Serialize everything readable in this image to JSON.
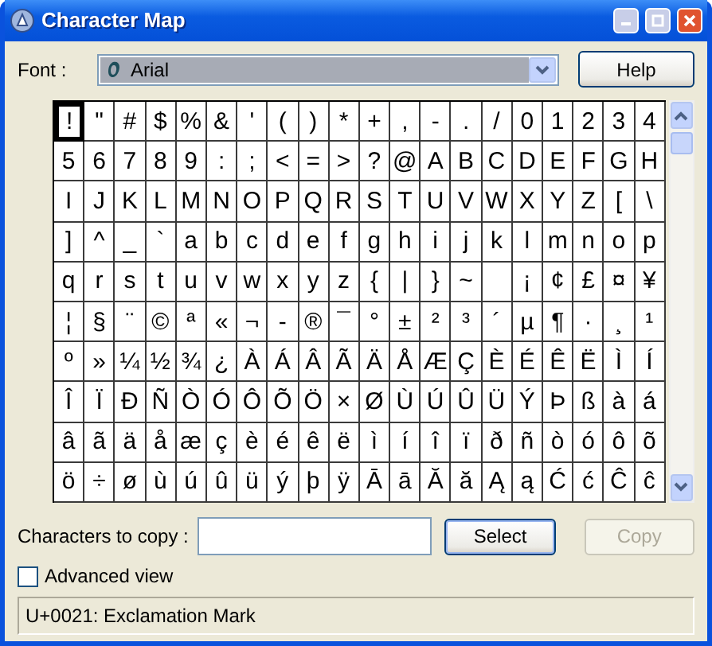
{
  "window": {
    "title": "Character Map"
  },
  "font": {
    "label": "Font :",
    "value": "Arial"
  },
  "help_button": "Help",
  "grid": {
    "rows": [
      {
        "cells": [
          {
            "c": "!",
            "selected": true
          },
          {
            "c": "\"",
            "selected": false
          },
          {
            "c": "#",
            "selected": false
          },
          {
            "c": "$",
            "selected": false
          },
          {
            "c": "%",
            "selected": false
          },
          {
            "c": "&",
            "selected": false
          },
          {
            "c": "'",
            "selected": false
          },
          {
            "c": "(",
            "selected": false
          },
          {
            "c": ")",
            "selected": false
          },
          {
            "c": "*",
            "selected": false
          },
          {
            "c": "+",
            "selected": false
          },
          {
            "c": ",",
            "selected": false
          },
          {
            "c": "-",
            "selected": false
          },
          {
            "c": ".",
            "selected": false
          },
          {
            "c": "/",
            "selected": false
          },
          {
            "c": "0",
            "selected": false
          },
          {
            "c": "1",
            "selected": false
          },
          {
            "c": "2",
            "selected": false
          },
          {
            "c": "3",
            "selected": false
          },
          {
            "c": "4",
            "selected": false
          }
        ]
      },
      {
        "cells": [
          {
            "c": "5",
            "selected": false
          },
          {
            "c": "6",
            "selected": false
          },
          {
            "c": "7",
            "selected": false
          },
          {
            "c": "8",
            "selected": false
          },
          {
            "c": "9",
            "selected": false
          },
          {
            "c": ":",
            "selected": false
          },
          {
            "c": ";",
            "selected": false
          },
          {
            "c": "<",
            "selected": false
          },
          {
            "c": "=",
            "selected": false
          },
          {
            "c": ">",
            "selected": false
          },
          {
            "c": "?",
            "selected": false
          },
          {
            "c": "@",
            "selected": false
          },
          {
            "c": "A",
            "selected": false
          },
          {
            "c": "B",
            "selected": false
          },
          {
            "c": "C",
            "selected": false
          },
          {
            "c": "D",
            "selected": false
          },
          {
            "c": "E",
            "selected": false
          },
          {
            "c": "F",
            "selected": false
          },
          {
            "c": "G",
            "selected": false
          },
          {
            "c": "H",
            "selected": false
          }
        ]
      },
      {
        "cells": [
          {
            "c": "I",
            "selected": false
          },
          {
            "c": "J",
            "selected": false
          },
          {
            "c": "K",
            "selected": false
          },
          {
            "c": "L",
            "selected": false
          },
          {
            "c": "M",
            "selected": false
          },
          {
            "c": "N",
            "selected": false
          },
          {
            "c": "O",
            "selected": false
          },
          {
            "c": "P",
            "selected": false
          },
          {
            "c": "Q",
            "selected": false
          },
          {
            "c": "R",
            "selected": false
          },
          {
            "c": "S",
            "selected": false
          },
          {
            "c": "T",
            "selected": false
          },
          {
            "c": "U",
            "selected": false
          },
          {
            "c": "V",
            "selected": false
          },
          {
            "c": "W",
            "selected": false
          },
          {
            "c": "X",
            "selected": false
          },
          {
            "c": "Y",
            "selected": false
          },
          {
            "c": "Z",
            "selected": false
          },
          {
            "c": "[",
            "selected": false
          },
          {
            "c": "\\",
            "selected": false
          }
        ]
      },
      {
        "cells": [
          {
            "c": "]",
            "selected": false
          },
          {
            "c": "^",
            "selected": false
          },
          {
            "c": "_",
            "selected": false
          },
          {
            "c": "`",
            "selected": false
          },
          {
            "c": "a",
            "selected": false
          },
          {
            "c": "b",
            "selected": false
          },
          {
            "c": "c",
            "selected": false
          },
          {
            "c": "d",
            "selected": false
          },
          {
            "c": "e",
            "selected": false
          },
          {
            "c": "f",
            "selected": false
          },
          {
            "c": "g",
            "selected": false
          },
          {
            "c": "h",
            "selected": false
          },
          {
            "c": "i",
            "selected": false
          },
          {
            "c": "j",
            "selected": false
          },
          {
            "c": "k",
            "selected": false
          },
          {
            "c": "l",
            "selected": false
          },
          {
            "c": "m",
            "selected": false
          },
          {
            "c": "n",
            "selected": false
          },
          {
            "c": "o",
            "selected": false
          },
          {
            "c": "p",
            "selected": false
          }
        ]
      },
      {
        "cells": [
          {
            "c": "q",
            "selected": false
          },
          {
            "c": "r",
            "selected": false
          },
          {
            "c": "s",
            "selected": false
          },
          {
            "c": "t",
            "selected": false
          },
          {
            "c": "u",
            "selected": false
          },
          {
            "c": "v",
            "selected": false
          },
          {
            "c": "w",
            "selected": false
          },
          {
            "c": "x",
            "selected": false
          },
          {
            "c": "y",
            "selected": false
          },
          {
            "c": "z",
            "selected": false
          },
          {
            "c": "{",
            "selected": false
          },
          {
            "c": "|",
            "selected": false
          },
          {
            "c": "}",
            "selected": false
          },
          {
            "c": "~",
            "selected": false
          },
          {
            "selected": false
          },
          {
            "c": "¡",
            "selected": false
          },
          {
            "c": "¢",
            "selected": false
          },
          {
            "c": "£",
            "selected": false
          },
          {
            "c": "¤",
            "selected": false
          },
          {
            "c": "¥",
            "selected": false
          }
        ]
      },
      {
        "cells": [
          {
            "c": "¦",
            "selected": false
          },
          {
            "c": "§",
            "selected": false
          },
          {
            "c": "¨",
            "selected": false
          },
          {
            "c": "©",
            "selected": false
          },
          {
            "c": "ª",
            "selected": false
          },
          {
            "c": "«",
            "selected": false
          },
          {
            "c": "¬",
            "selected": false
          },
          {
            "c": "-",
            "selected": false
          },
          {
            "c": "®",
            "selected": false
          },
          {
            "c": "¯",
            "selected": false
          },
          {
            "c": "°",
            "selected": false
          },
          {
            "c": "±",
            "selected": false
          },
          {
            "c": "²",
            "selected": false
          },
          {
            "c": "³",
            "selected": false
          },
          {
            "c": "´",
            "selected": false
          },
          {
            "c": "µ",
            "selected": false
          },
          {
            "c": "¶",
            "selected": false
          },
          {
            "c": "·",
            "selected": false
          },
          {
            "c": "¸",
            "selected": false
          },
          {
            "c": "¹",
            "selected": false
          }
        ]
      },
      {
        "cells": [
          {
            "c": "º",
            "selected": false
          },
          {
            "c": "»",
            "selected": false
          },
          {
            "c": "¼",
            "selected": false
          },
          {
            "c": "½",
            "selected": false
          },
          {
            "c": "¾",
            "selected": false
          },
          {
            "c": "¿",
            "selected": false
          },
          {
            "c": "À",
            "selected": false
          },
          {
            "c": "Á",
            "selected": false
          },
          {
            "c": "Â",
            "selected": false
          },
          {
            "c": "Ã",
            "selected": false
          },
          {
            "c": "Ä",
            "selected": false
          },
          {
            "c": "Å",
            "selected": false
          },
          {
            "c": "Æ",
            "selected": false
          },
          {
            "c": "Ç",
            "selected": false
          },
          {
            "c": "È",
            "selected": false
          },
          {
            "c": "É",
            "selected": false
          },
          {
            "c": "Ê",
            "selected": false
          },
          {
            "c": "Ë",
            "selected": false
          },
          {
            "c": "Ì",
            "selected": false
          },
          {
            "c": "Í",
            "selected": false
          }
        ]
      },
      {
        "cells": [
          {
            "c": "Î",
            "selected": false
          },
          {
            "c": "Ï",
            "selected": false
          },
          {
            "c": "Ð",
            "selected": false
          },
          {
            "c": "Ñ",
            "selected": false
          },
          {
            "c": "Ò",
            "selected": false
          },
          {
            "c": "Ó",
            "selected": false
          },
          {
            "c": "Ô",
            "selected": false
          },
          {
            "c": "Õ",
            "selected": false
          },
          {
            "c": "Ö",
            "selected": false
          },
          {
            "c": "×",
            "selected": false
          },
          {
            "c": "Ø",
            "selected": false
          },
          {
            "c": "Ù",
            "selected": false
          },
          {
            "c": "Ú",
            "selected": false
          },
          {
            "c": "Û",
            "selected": false
          },
          {
            "c": "Ü",
            "selected": false
          },
          {
            "c": "Ý",
            "selected": false
          },
          {
            "c": "Þ",
            "selected": false
          },
          {
            "c": "ß",
            "selected": false
          },
          {
            "c": "à",
            "selected": false
          },
          {
            "c": "á",
            "selected": false
          }
        ]
      },
      {
        "cells": [
          {
            "c": "â",
            "selected": false
          },
          {
            "c": "ã",
            "selected": false
          },
          {
            "c": "ä",
            "selected": false
          },
          {
            "c": "å",
            "selected": false
          },
          {
            "c": "æ",
            "selected": false
          },
          {
            "c": "ç",
            "selected": false
          },
          {
            "c": "è",
            "selected": false
          },
          {
            "c": "é",
            "selected": false
          },
          {
            "c": "ê",
            "selected": false
          },
          {
            "c": "ë",
            "selected": false
          },
          {
            "c": "ì",
            "selected": false
          },
          {
            "c": "í",
            "selected": false
          },
          {
            "c": "î",
            "selected": false
          },
          {
            "c": "ï",
            "selected": false
          },
          {
            "c": "ð",
            "selected": false
          },
          {
            "c": "ñ",
            "selected": false
          },
          {
            "c": "ò",
            "selected": false
          },
          {
            "c": "ó",
            "selected": false
          },
          {
            "c": "ô",
            "selected": false
          },
          {
            "c": "õ",
            "selected": false
          }
        ]
      },
      {
        "cells": [
          {
            "c": "ö",
            "selected": false
          },
          {
            "c": "÷",
            "selected": false
          },
          {
            "c": "ø",
            "selected": false
          },
          {
            "c": "ù",
            "selected": false
          },
          {
            "c": "ú",
            "selected": false
          },
          {
            "c": "û",
            "selected": false
          },
          {
            "c": "ü",
            "selected": false
          },
          {
            "c": "ý",
            "selected": false
          },
          {
            "c": "þ",
            "selected": false
          },
          {
            "c": "ÿ",
            "selected": false
          },
          {
            "c": "Ā",
            "selected": false
          },
          {
            "c": "ā",
            "selected": false
          },
          {
            "c": "Ă",
            "selected": false
          },
          {
            "c": "ă",
            "selected": false
          },
          {
            "c": "Ą",
            "selected": false
          },
          {
            "c": "ą",
            "selected": false
          },
          {
            "c": "Ć",
            "selected": false
          },
          {
            "c": "ć",
            "selected": false
          },
          {
            "c": "Ĉ",
            "selected": false
          },
          {
            "c": "ĉ",
            "selected": false
          }
        ]
      }
    ]
  },
  "copy": {
    "label": "Characters to copy :",
    "select_button": "Select",
    "copy_button": {
      "label": "Copy",
      "disabled": true
    }
  },
  "advanced_view": {
    "label": "Advanced view",
    "checked": false
  },
  "status_bar": "U+0021: Exclamation Mark"
}
